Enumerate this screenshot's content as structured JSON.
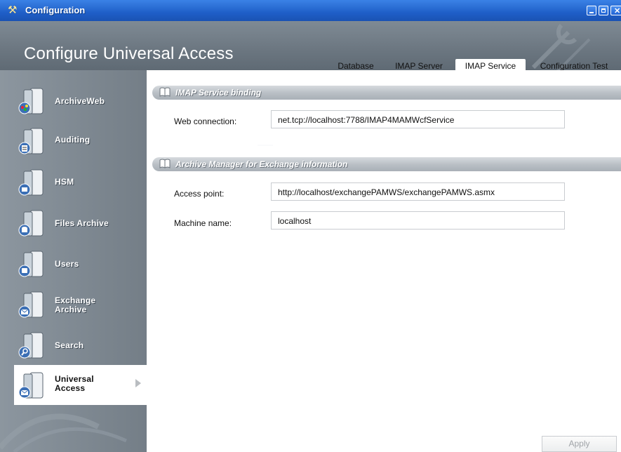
{
  "window": {
    "title": "Configuration",
    "icon": "tools-icon"
  },
  "header": {
    "title": "Configure Universal Access"
  },
  "tabs": [
    {
      "label": "Database",
      "active": false
    },
    {
      "label": "IMAP Server",
      "active": false
    },
    {
      "label": "IMAP Service",
      "active": true
    },
    {
      "label": "Configuration Test",
      "active": false
    }
  ],
  "sidebar": {
    "items": [
      {
        "label": "ArchiveWeb",
        "icon": "archiveweb-icon"
      },
      {
        "label": "Auditing",
        "icon": "auditing-icon"
      },
      {
        "label": "HSM",
        "icon": "hsm-icon"
      },
      {
        "label": "Files Archive",
        "icon": "files-archive-icon"
      },
      {
        "label": "Users",
        "icon": "users-icon"
      },
      {
        "label": "Exchange Archive",
        "line1": "Exchange",
        "line2": "Archive",
        "icon": "exchange-archive-icon"
      },
      {
        "label": "Search",
        "icon": "search-icon"
      },
      {
        "label": "Universal Access",
        "line1": "Universal",
        "line2": "Access",
        "icon": "universal-access-icon",
        "selected": true
      }
    ]
  },
  "sections": {
    "binding": {
      "title": "IMAP Service binding",
      "web_connection_label": "Web connection:",
      "web_connection_value": "net.tcp://localhost:7788/IMAP4MAMWcfService"
    },
    "amfe": {
      "title": "Archive Manager for Exchange information",
      "access_point_label": "Access point:",
      "access_point_value": "http://localhost/exchangePAMWS/exchangePAMWS.asmx",
      "machine_name_label": "Machine name:",
      "machine_name_value": "localhost"
    }
  },
  "footer": {
    "apply_label": "Apply"
  },
  "colors": {
    "titlebar": "#1f5fc8",
    "header": "#6b7680",
    "sidebar": "#7b858e",
    "section": "#b8bec4"
  }
}
